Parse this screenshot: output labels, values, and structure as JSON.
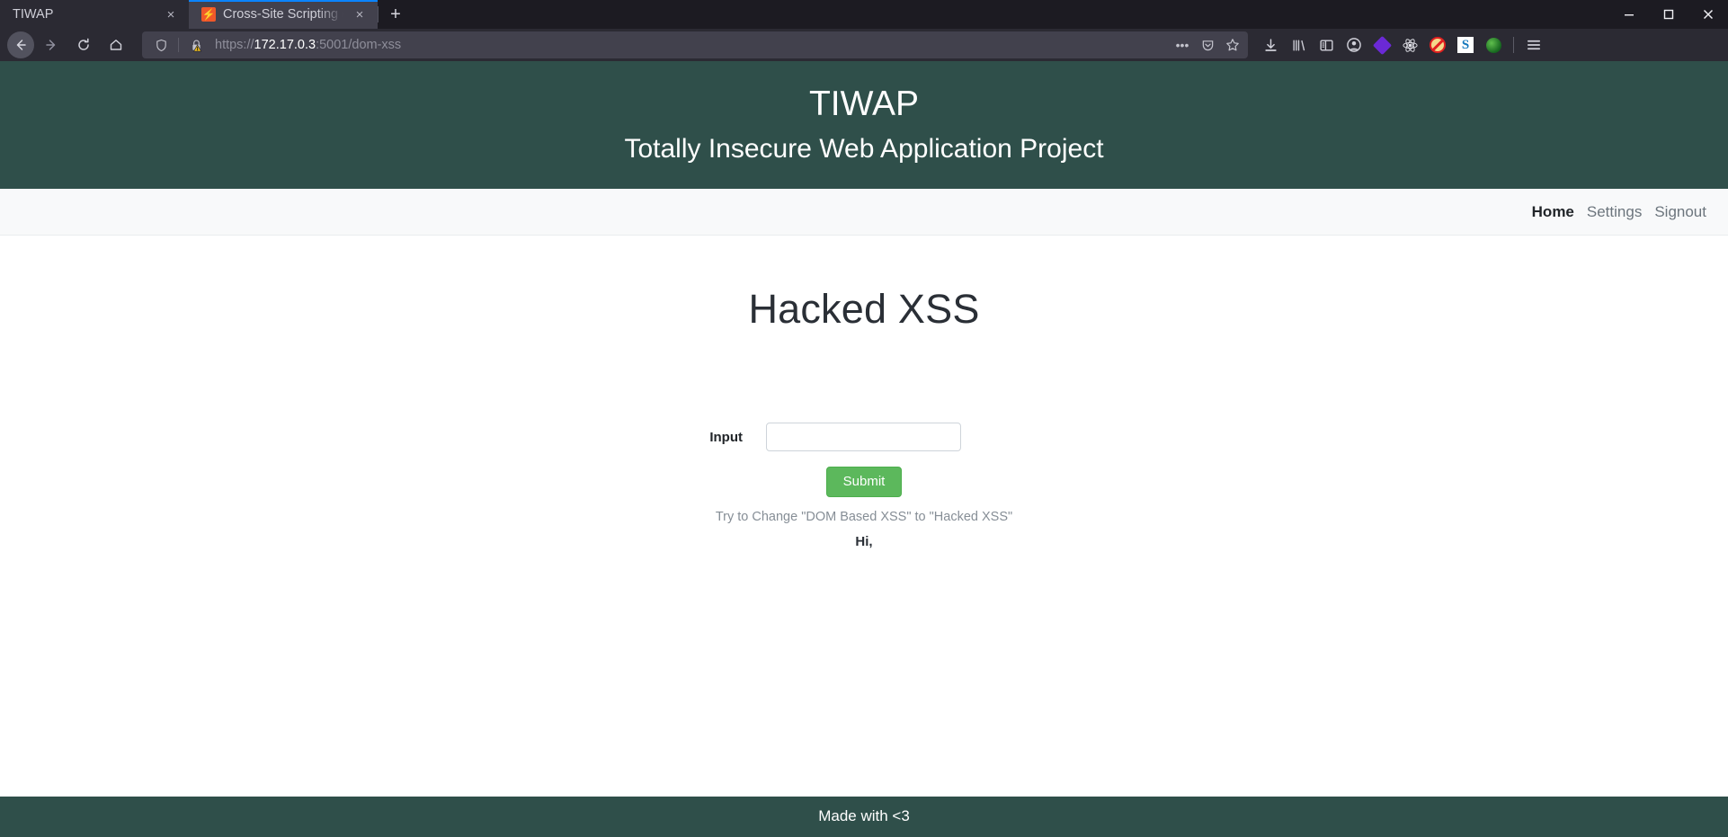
{
  "browser": {
    "tabs": [
      {
        "title": "TIWAP",
        "active": true,
        "favicon": "none"
      },
      {
        "title": "Cross-Site Scripting (XSS)",
        "active": false,
        "favicon": "lightning-bolt-icon"
      }
    ],
    "new_tab_label": "+",
    "close_label": "×",
    "window_controls": {
      "minimize": "–",
      "maximize": "□",
      "close": "×"
    },
    "nav": {
      "back_icon": "back-arrow-icon",
      "forward_icon": "forward-arrow-icon",
      "reload_icon": "reload-icon",
      "home_icon": "home-icon"
    },
    "url": {
      "scheme": "https://",
      "host": "172.17.0.3",
      "path": ":5001/dom-xss",
      "full": "https://172.17.0.3:5001/dom-xss",
      "shield_icon": "tracking-protection-shield-icon",
      "lock_icon": "insecure-warning-lock-icon",
      "page_actions_label": "•••",
      "pocket_icon": "pocket-icon",
      "bookmark_icon": "star-bookmark-icon"
    },
    "toolbar_icons": [
      "downloads-icon",
      "library-icon",
      "sidebar-icon",
      "account-icon",
      "extension-diamond-icon",
      "react-devtools-icon",
      "noscript-icon",
      "extension-s-icon",
      "extension-green-icon",
      "app-menu-icon"
    ]
  },
  "site": {
    "title": "TIWAP",
    "subtitle": "Totally Insecure Web Application Project",
    "nav_links": [
      {
        "label": "Home",
        "active": true
      },
      {
        "label": "Settings",
        "active": false
      },
      {
        "label": "Signout",
        "active": false
      }
    ],
    "footer": "Made with <3"
  },
  "main": {
    "heading": "Hacked XSS",
    "form": {
      "input_label": "Input",
      "input_value": "",
      "input_placeholder": "",
      "submit_label": "Submit"
    },
    "hint": "Try to Change \"DOM Based XSS\" to \"Hacked XSS\"",
    "greeting": "Hi,"
  },
  "colors": {
    "header_teal": "#2f4f4a",
    "submit_green": "#5cb85c",
    "nav_bg": "#f8f9fa",
    "chrome_dark": "#1c1b22",
    "tab_active": "#2b2a33",
    "accent_blue": "#0a84ff"
  }
}
